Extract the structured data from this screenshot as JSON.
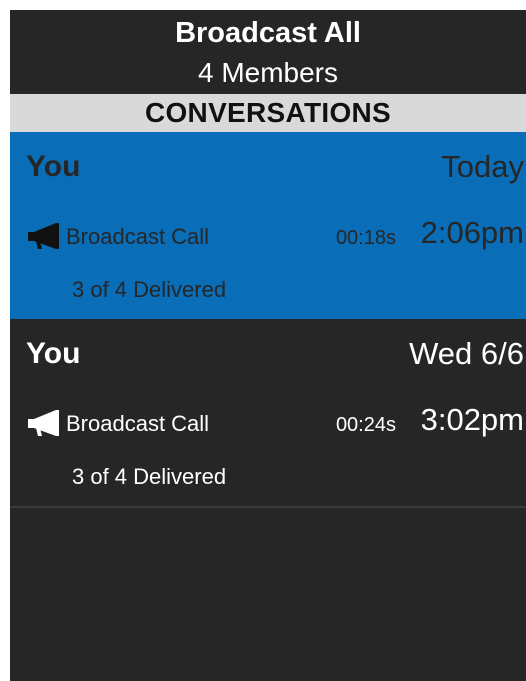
{
  "header": {
    "group_name": "Broadcast All",
    "member_count": "4 Members"
  },
  "section": {
    "title": "CONVERSATIONS"
  },
  "conversations": [
    {
      "sender": "You",
      "date": "Today",
      "call_icon": "megaphone-icon",
      "call_label": "Broadcast Call",
      "duration": "00:18s",
      "time": "2:06pm",
      "delivery_status": "3 of 4 Delivered",
      "selected": true
    },
    {
      "sender": "You",
      "date": "Wed 6/6",
      "call_icon": "megaphone-icon",
      "call_label": "Broadcast Call",
      "duration": "00:24s",
      "time": "3:02pm",
      "delivery_status": "3 of 4 Delivered",
      "selected": false
    }
  ],
  "colors": {
    "background": "#262626",
    "header_text": "#ffffff",
    "section_bar": "#d9d9d9",
    "selected_row": "#0a6db8",
    "selected_text": "#262626",
    "divider": "#3a3a3a"
  }
}
